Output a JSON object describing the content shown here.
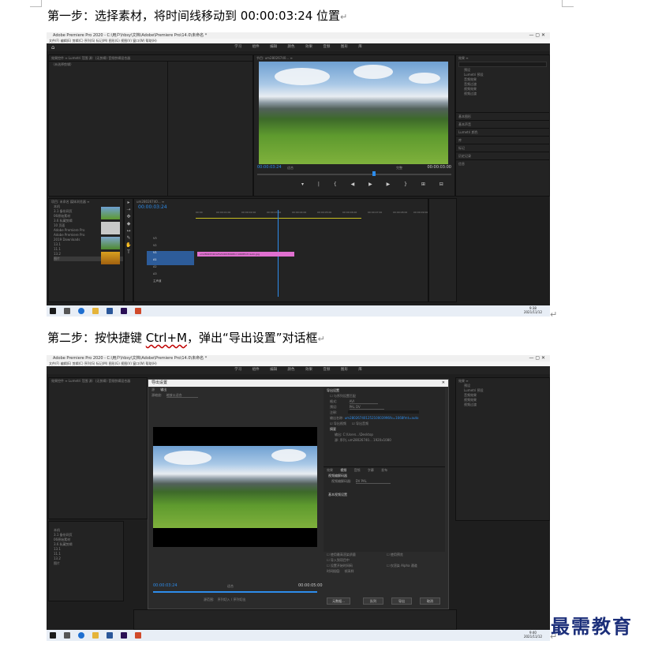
{
  "step1": {
    "heading": "第一步：选择素材，将时间线移动到 00:00:03:24 位置"
  },
  "step2": {
    "heading_before": "第二步：按快捷键 ",
    "heading_key": "Ctrl+M",
    "heading_after": "，弹出“导出设置”对话框"
  },
  "pilcrow": "↵",
  "screenshot1": {
    "window_title": "Adobe Premiere Pro 2020 - C:\\用户\\hbsy\\文档\\Adobe\\Premiere Pro\\14.0\\未命名 *",
    "menu": "文件(F)   编辑(E)   剪辑(C)   序列(S)   标记(M)   图形(G)   视图(V)   窗口(W)   帮助(H)",
    "workspaces": "学习 组件 编辑 颜色 效果 音频 图形 库",
    "source_tabs": "效果控件 ≡   Lumetri 范围   源：(无剪辑)   音频剪辑混合器",
    "source_empty": "（未选择剪辑）",
    "program_label": "节目: um28026740... ≡",
    "program_timecode_left": "00:00:03:24",
    "program_fit": "适合",
    "program_quality": "完整",
    "program_timecode_right": "00:00:03:00",
    "effects_title": "效果 ≡",
    "effects_items": [
      "预设",
      "Lumetri 预设",
      "音频效果",
      "音频过渡",
      "视频效果",
      "视频过渡"
    ],
    "effects_sections": [
      "基本图形",
      "基本声音",
      "Lumetri 颜色",
      "库",
      "标记",
      "历史记录",
      "信息"
    ],
    "project_tabs": "项目: 未命名   媒体浏览器 ≡",
    "media_items": [
      "本机",
      "3.1 备份网页",
      "06原始素材",
      "3.6 私藏剪辑",
      "10 页面",
      "Adobe Premiere Pro",
      "Adobe Premiere Pro",
      "2019 Downloads",
      "13.1",
      "11.1",
      "13.2",
      "图片"
    ],
    "timeline_tab": "um28026740... ≡",
    "timeline_timecode": "00:00:03:24",
    "ruler": [
      "00:00",
      "00:00:01:00",
      "00:00:02:00",
      "00:00:03:00",
      "00:00:04:00",
      "00:00:05:00",
      "00:00:06:00",
      "00:00:07:00",
      "00:00:08:00",
      "00:00:09:00"
    ],
    "tracks": [
      "V3",
      "V2",
      "V1",
      "A1",
      "A2",
      "A3"
    ],
    "master": "主声道",
    "clip_name": "um28026740125210003996fx=1668fmt=auto.jpg",
    "clock_time": "9:38",
    "clock_date": "2021/11/12"
  },
  "screenshot2": {
    "window_title": "Adobe Premiere Pro 2020 - C:\\用户\\hbsy\\文档\\Adobe\\Premiere Pro\\14.0\\未命名 *",
    "dialog_title": "导出设置",
    "tabs": [
      "源",
      "输出"
    ],
    "source_scaling_label": "源缩放:",
    "source_scaling_value": "缩放以适合",
    "export_heading": "导出设置",
    "match_sequence": "与序列设置匹配",
    "format_label": "格式:",
    "format_value": "AVI",
    "preset_label": "预设:",
    "preset_value": "PAL DV",
    "comments_label": "注释:",
    "output_name_label": "输出名称:",
    "output_name_value": "um28026740125210003996fx=1668fmt=auto",
    "export_video": "导出视频",
    "export_audio": "导出音频",
    "summary_heading": "摘要",
    "summary_output": "输出: C:\\Users...\\Desktop",
    "summary_source": "源: 序列, um28026740... 1920x1080",
    "setting_tabs": [
      "效果",
      "视频",
      "音频",
      "字幕",
      "发布"
    ],
    "video_codec_heading": "视频编解码器",
    "video_codec_label": "视频编解码器:",
    "video_codec_value": "DV PAL",
    "basic_video_heading": "基本视频设置",
    "options": [
      "使用最高渲染质量",
      "使用预览",
      "导入到项目中",
      "设置开始时间码",
      "仅渲染 Alpha 通道"
    ],
    "time_interpolation_label": "时间插值:",
    "time_interpolation_value": "帧采样",
    "btn_metadata": "元数据...",
    "btn_queue": "队列",
    "btn_export": "导出",
    "btn_cancel": "取消",
    "tc_left": "00:00:03:24",
    "tc_right": "00:00:05:00",
    "fit_label": "适合",
    "source_range_label": "源范围:",
    "source_range_value": "序列切入 / 序列切出",
    "clock_time": "9:40",
    "clock_date": "2021/11/12"
  },
  "watermark": "最需教育",
  "colors": {
    "premiere_bg": "#1e1e1e",
    "accent_blue": "#2d8ceb",
    "clip_pink": "#e070d0",
    "watermark": "#1c2f7a"
  }
}
